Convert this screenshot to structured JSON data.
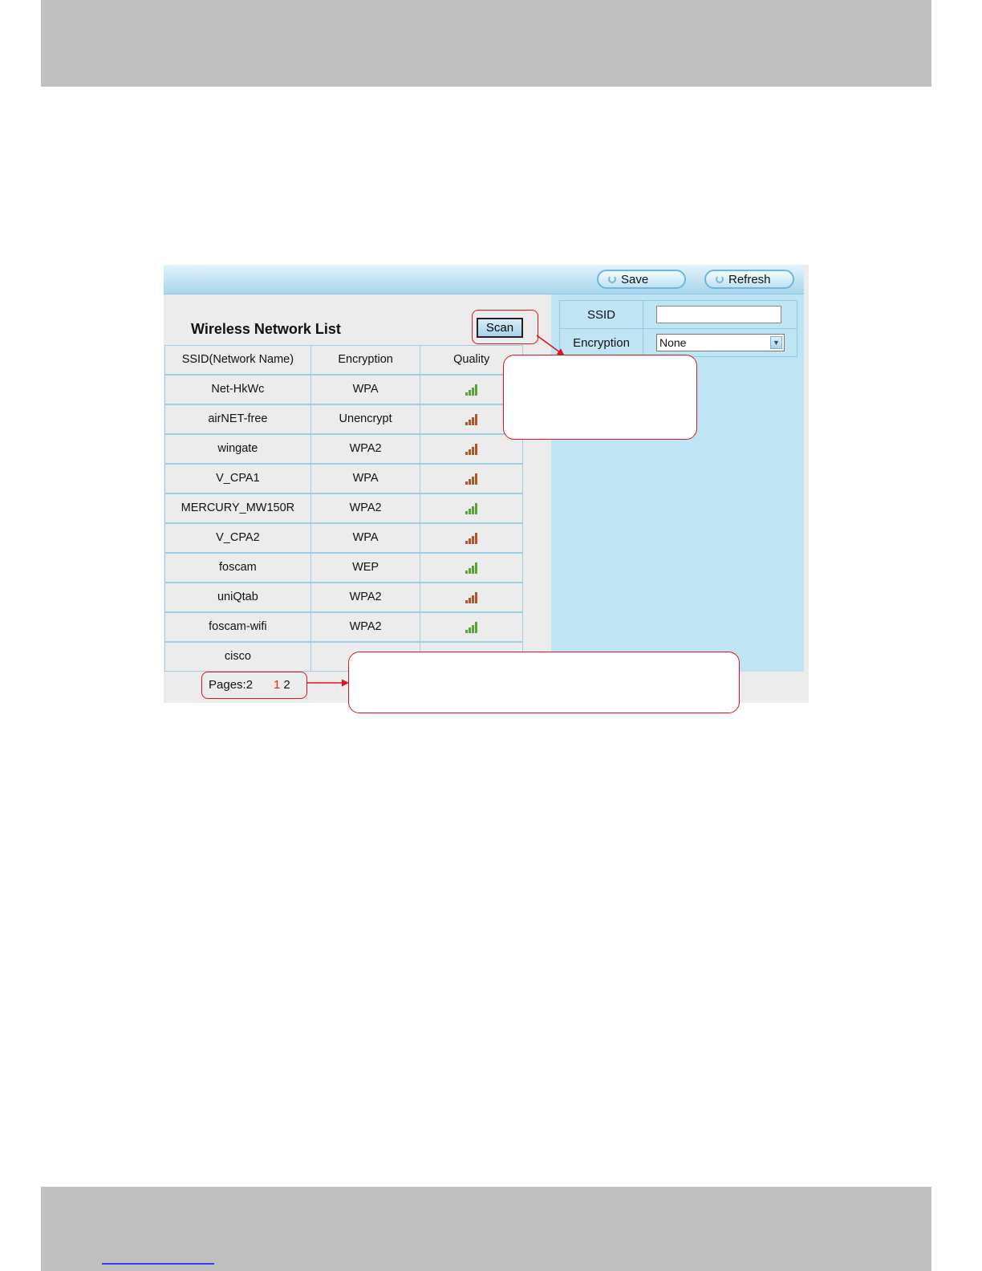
{
  "toolbar": {
    "save_label": "Save",
    "refresh_label": "Refresh"
  },
  "settings": {
    "ssid_label": "SSID",
    "ssid_value": "",
    "encryption_label": "Encryption",
    "encryption_value": "None"
  },
  "list": {
    "title": "Wireless Network List",
    "scan_label": "Scan",
    "columns": [
      "SSID(Network Name)",
      "Encryption",
      "Quality"
    ],
    "rows": [
      {
        "ssid": "Net-HkWc",
        "encryption": "WPA",
        "quality_color": "#5aa33a"
      },
      {
        "ssid": "airNET-free",
        "encryption": "Unencrypt",
        "quality_color": "#b0562d"
      },
      {
        "ssid": "wingate",
        "encryption": "WPA2",
        "quality_color": "#b0562d"
      },
      {
        "ssid": "V_CPA1",
        "encryption": "WPA",
        "quality_color": "#b0562d"
      },
      {
        "ssid": "MERCURY_MW150R",
        "encryption": "WPA2",
        "quality_color": "#5aa33a"
      },
      {
        "ssid": "V_CPA2",
        "encryption": "WPA",
        "quality_color": "#b0562d"
      },
      {
        "ssid": "foscam",
        "encryption": "WEP",
        "quality_color": "#5aa33a"
      },
      {
        "ssid": "uniQtab",
        "encryption": "WPA2",
        "quality_color": "#b0562d"
      },
      {
        "ssid": "foscam-wifi",
        "encryption": "WPA2",
        "quality_color": "#5aa33a"
      },
      {
        "ssid": "cisco",
        "encryption": "",
        "quality_color": ""
      }
    ]
  },
  "pager": {
    "label": "Pages:2",
    "current": "1",
    "next": "2"
  },
  "colors": {
    "annotation_red": "#e0141c",
    "panel_blue": "#bfe5f4",
    "band_gray": "#c0c0c0"
  }
}
